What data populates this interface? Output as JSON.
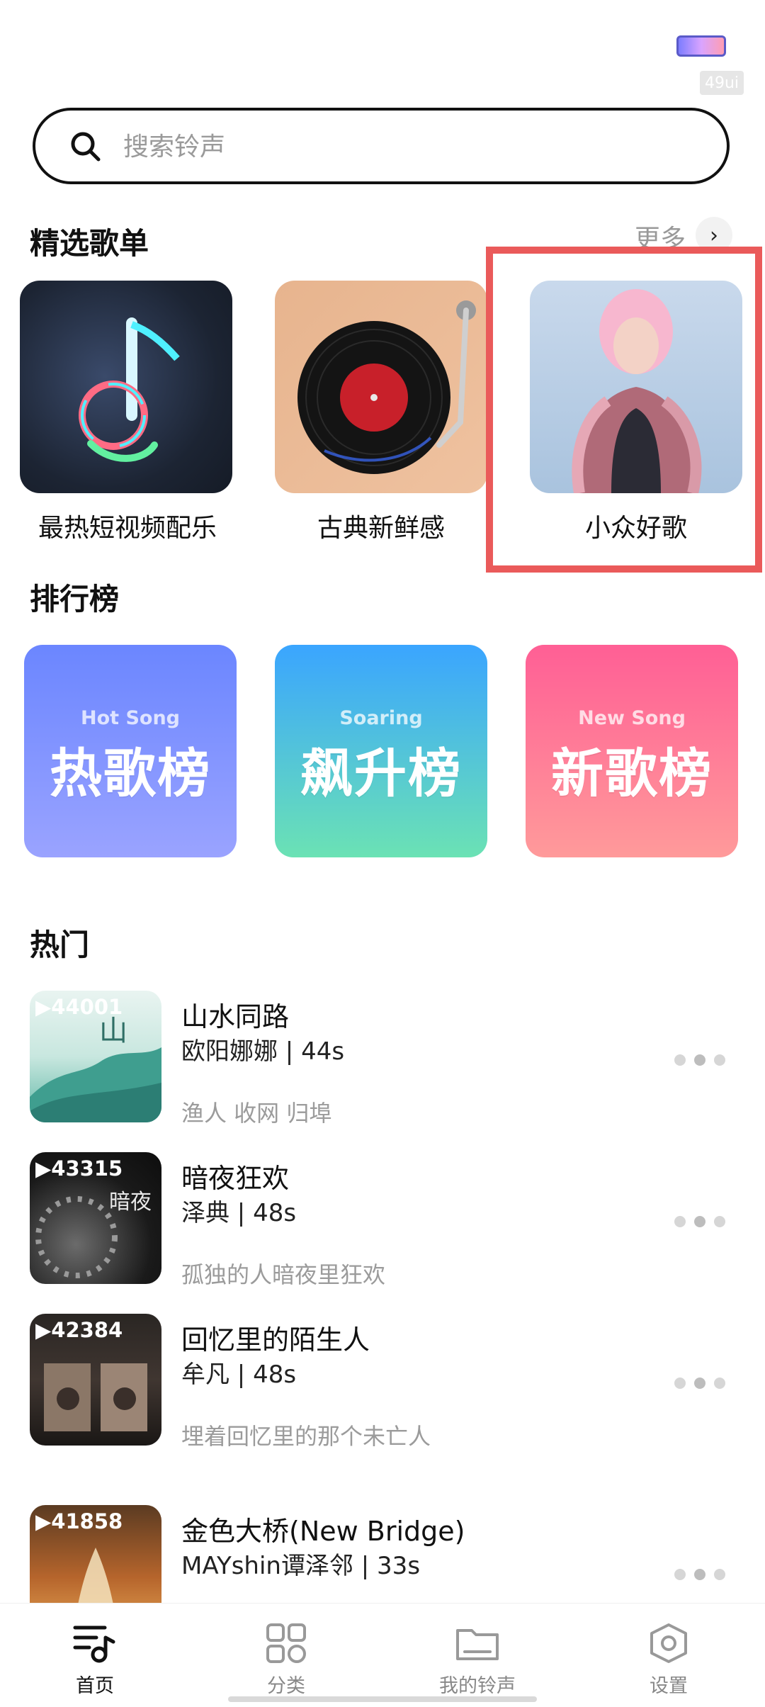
{
  "status": {
    "tag": "49ui"
  },
  "search": {
    "placeholder": "搜索铃声"
  },
  "featured": {
    "title": "精选歌单",
    "more_label": "更多",
    "items": [
      {
        "label": "最热短视频配乐"
      },
      {
        "label": "古典新鲜感"
      },
      {
        "label": "小众好歌"
      }
    ]
  },
  "charts": {
    "title": "排行榜",
    "items": [
      {
        "sub": "Hot Song",
        "main": "热歌榜"
      },
      {
        "sub": "Soaring",
        "main": "飙升榜"
      },
      {
        "sub": "New Song",
        "main": "新歌榜"
      }
    ]
  },
  "hot": {
    "title": "热门",
    "songs": [
      {
        "count": "▶44001",
        "title": "山水同路",
        "meta": "欧阳娜娜 | 44s",
        "desc": "渔人 收网 归埠"
      },
      {
        "count": "▶43315",
        "title": "暗夜狂欢",
        "meta": "泽典 | 48s",
        "desc": "孤独的人暗夜里狂欢"
      },
      {
        "count": "▶42384",
        "title": "回忆里的陌生人",
        "meta": "牟凡 | 48s",
        "desc": "埋着回忆里的那个未亡人"
      },
      {
        "count": "▶41858",
        "title": "金色大桥(New Bridge)",
        "meta": "MAYshin谭泽邻 | 33s",
        "desc": ""
      }
    ]
  },
  "tabbar": {
    "items": [
      {
        "label": "首页"
      },
      {
        "label": "分类"
      },
      {
        "label": "我的铃声"
      },
      {
        "label": "设置"
      }
    ]
  },
  "colors": {
    "highlight": "#ea5a5a"
  }
}
